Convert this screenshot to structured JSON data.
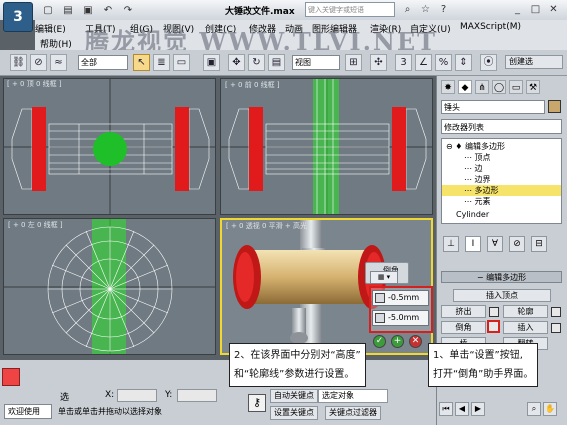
{
  "title_bar": {
    "title": "大锤改文件.max",
    "search_placeholder": "键入关键字或短语",
    "qat_icons": [
      "new-icon",
      "open-icon",
      "save-icon",
      "undo-icon",
      "redo-icon"
    ]
  },
  "menu": {
    "items": [
      "编辑(E)",
      "工具(T)",
      "组(G)",
      "视图(V)",
      "创建(C)",
      "修改器",
      "动画",
      "图形编辑器",
      "渲染(R)",
      "自定义(U)",
      "MAXScript(M)",
      "帮助(H)"
    ]
  },
  "watermark": "腾龙视觉 WWW.TLVI.NET",
  "toolbar": {
    "selection_filter": "全部",
    "reference_coord": "视图",
    "create_selection_label": "创建选"
  },
  "viewports": [
    {
      "label": "[ + 0 顶 0 线框 ]"
    },
    {
      "label": "[ + 0 前 0 线框 ]"
    },
    {
      "label": "[ + 0 左 0 线框 ]"
    },
    {
      "label": "[ + 0 透视 0 平滑 + 高光 ]"
    }
  ],
  "command_panel": {
    "object_name": "锤头",
    "object_color": "#c9a66b",
    "modifier_list": "修改器列表",
    "stack": [
      {
        "label": "编辑多边形",
        "level": 0,
        "selected": false
      },
      {
        "label": "顶点",
        "level": 1,
        "selected": false
      },
      {
        "label": "边",
        "level": 1,
        "selected": false
      },
      {
        "label": "边界",
        "level": 1,
        "selected": false
      },
      {
        "label": "多边形",
        "level": 1,
        "selected": true
      },
      {
        "label": "元素",
        "level": 1,
        "selected": false
      },
      {
        "label": "Cylinder",
        "level": 0,
        "selected": false
      }
    ],
    "rollout_title": "编辑多边形",
    "insert_vertex": "插入顶点",
    "extrude": "挤出",
    "outline": "轮廓",
    "bevel": "倒角",
    "inset": "插入",
    "bridge": "桥",
    "flip": "翻转"
  },
  "caddy": {
    "title": "倒角",
    "height_value": "-0.5mm",
    "outline_value": "-5.0mm"
  },
  "annotations": {
    "left_line1": "2、在该界面中分别对“高度”",
    "left_line2": "和“轮廓线”参数进行设置。",
    "right_line1": "1、单击“设置”按钮,",
    "right_line2": "打开“倒角”助手界面。"
  },
  "status": {
    "welcome": "欢迎使用",
    "selected_label": "选",
    "x_label": "X:",
    "y_label": "Y:",
    "hint": "单击或单击并拖动以选择对象",
    "auto_key": "自动关键点",
    "selected_object": "选定对象",
    "set_key": "设置关键点",
    "key_filters": "关键点过滤器"
  }
}
